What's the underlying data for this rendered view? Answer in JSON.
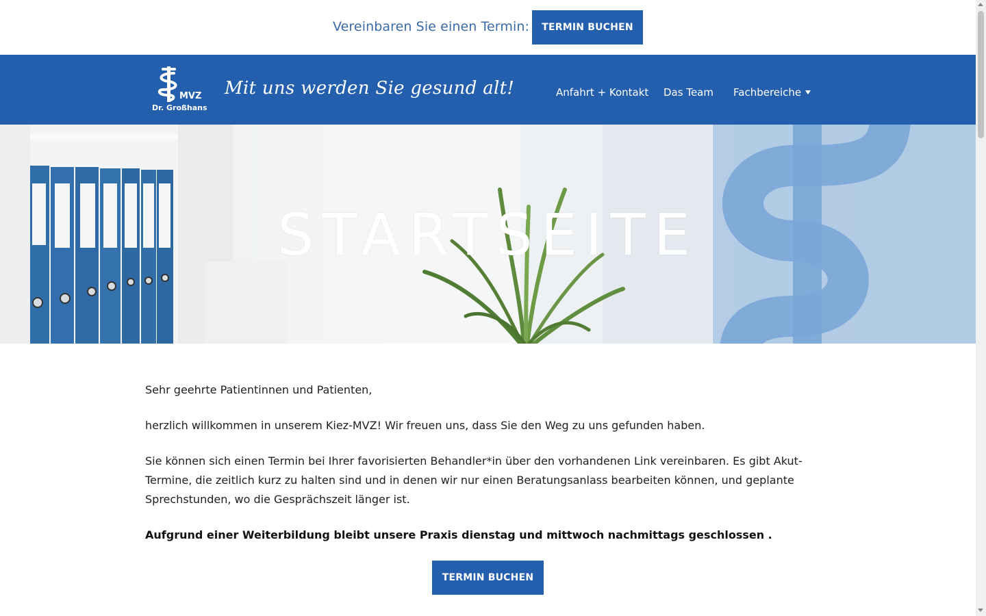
{
  "topbar": {
    "text": "Vereinbaren Sie einen Termin:",
    "button_label": "TERMIN BUCHEN"
  },
  "header": {
    "logo": {
      "mvz": "MVZ",
      "name": "Dr. Großhans",
      "icon": "staff-of-asclepius-icon"
    },
    "tagline": "Mit uns werden Sie gesund alt!",
    "nav": [
      {
        "label": "Anfahrt + Kontakt"
      },
      {
        "label": "Das Team"
      },
      {
        "label": "Fachbereiche",
        "icon": "caret-down-icon"
      }
    ]
  },
  "hero": {
    "title": "STARTSEITE"
  },
  "content": {
    "greeting": "Sehr geehrte Patientinnen und Patienten,",
    "welcome": "herzlich willkommen in unserem Kiez-MVZ! Wir freuen uns, dass Sie den Weg zu uns gefunden haben.",
    "info": "Sie können sich einen Termin bei Ihrer favorisierten Behandler*in über den vorhandenen Link vereinbaren. Es gibt Akut-Termine, die zeitlich kurz zu halten sind und in denen wir nur einen Beratungsanlass bearbeiten können, und geplante Sprechstunden, wo die Gesprächszeit länger ist.",
    "notice": "Aufgrund einer Weiterbildung bleibt unsere Praxis dienstag und mittwoch nachmittags geschlossen .",
    "button_label": "TERMIN BUCHEN"
  },
  "colors": {
    "brand_blue": "#235fad",
    "topbar_text": "#3a6aa8"
  }
}
